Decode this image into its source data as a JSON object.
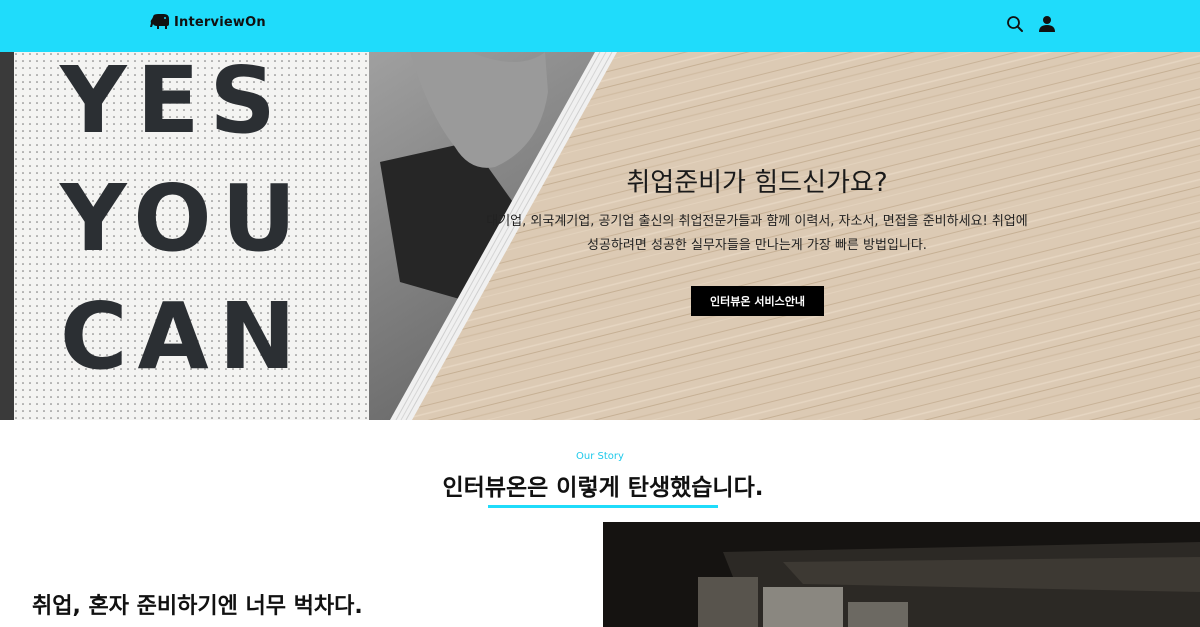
{
  "header": {
    "logo_text": "InterviewOn",
    "logo_icon": "elephant-logo-icon",
    "search_icon": "search-icon",
    "user_icon": "user-icon",
    "background_color": "#1fdcfb"
  },
  "hero": {
    "sign_lines": [
      "YES",
      "YOU",
      "CAN"
    ],
    "title": "취업준비가 힘드신가요?",
    "description_line1": "대기업, 외국계기업, 공기업 출신의 취업전문가들과 함께 이력서, 자소서, 면접을 준비하세요! 취업에",
    "description_line2": "성공하려면 성공한 실무자들을 만나는게 가장 빠른 방법입니다.",
    "button_label": "인터뷰온 서비스안내"
  },
  "story": {
    "kicker": "Our Story",
    "title": "인터뷰온은 이렇게 탄생했습니다.",
    "heading": "취업, 혼자 준비하기엔 너무 벅차다.",
    "accent_color": "#1fdcfb"
  }
}
